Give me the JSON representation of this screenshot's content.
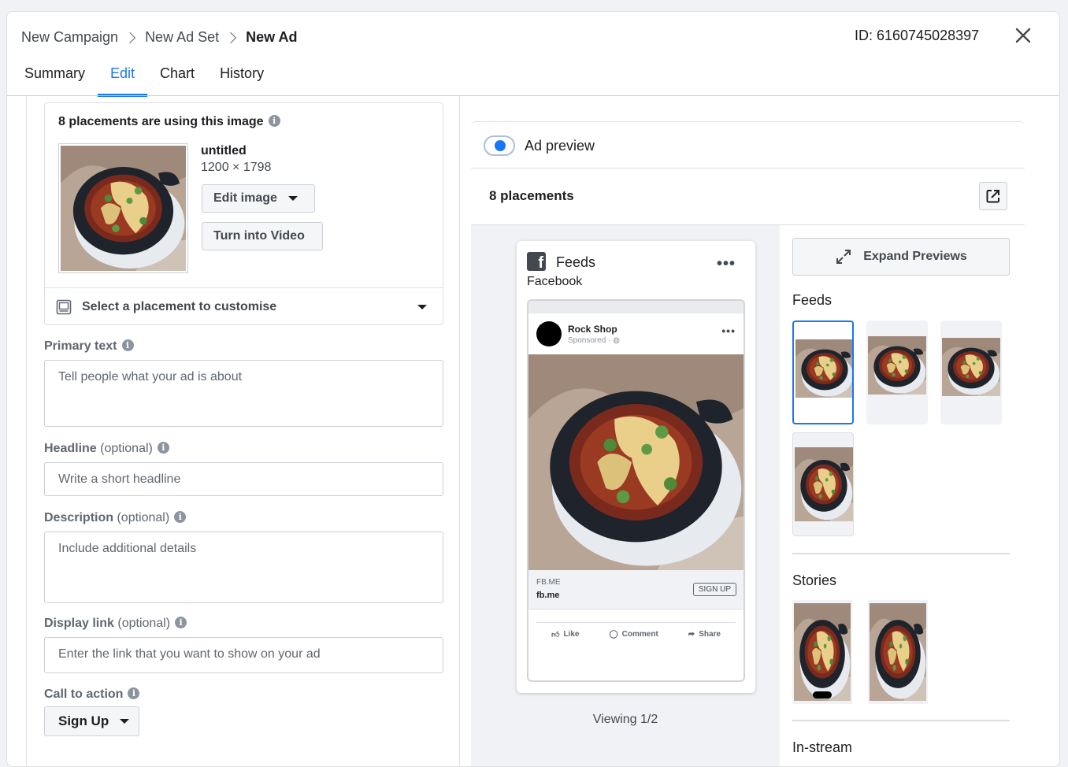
{
  "breadcrumb": [
    "New Campaign",
    "New Ad Set",
    "New Ad"
  ],
  "ad_id": "ID: 6160745028397",
  "tabs": [
    "Summary",
    "Edit",
    "Chart",
    "History"
  ],
  "active_tab": "Edit",
  "image_card": {
    "title": "8 placements are using this image",
    "image_name": "untitled",
    "image_dims": "1200 × 1798",
    "edit_image_label": "Edit image",
    "turn_into_video_label": "Turn into Video",
    "placement_select": "Select a placement to customise"
  },
  "form": {
    "primary_text": {
      "label": "Primary text",
      "placeholder": "Tell people what your ad is about"
    },
    "headline": {
      "label": "Headline",
      "optional": "(optional)",
      "placeholder": "Write a short headline"
    },
    "description": {
      "label": "Description",
      "optional": "(optional)",
      "placeholder": "Include additional details"
    },
    "display_link": {
      "label": "Display link",
      "optional": "(optional)",
      "placeholder": "Enter the link that you want to show on your ad"
    },
    "cta": {
      "label": "Call to action",
      "value": "Sign Up"
    }
  },
  "preview": {
    "toggle_label": "Ad preview",
    "placements_title": "8 placements",
    "card_title": "Feeds",
    "card_subtitle": "Facebook",
    "page_name": "Rock Shop",
    "sponsored": "Sponsored ·",
    "link_caption": "FB.ME",
    "link_domain": "fb.me",
    "cta_button": "SIGN UP",
    "actions": [
      "Like",
      "Comment",
      "Share"
    ],
    "viewing": "Viewing 1/2",
    "expand_label": "Expand Previews",
    "sections": [
      "Feeds",
      "Stories",
      "In-stream"
    ]
  },
  "colors": {
    "accent": "#1877f2",
    "text": "#1c1e21",
    "muted": "#606770",
    "bg": "#f0f2f5"
  }
}
